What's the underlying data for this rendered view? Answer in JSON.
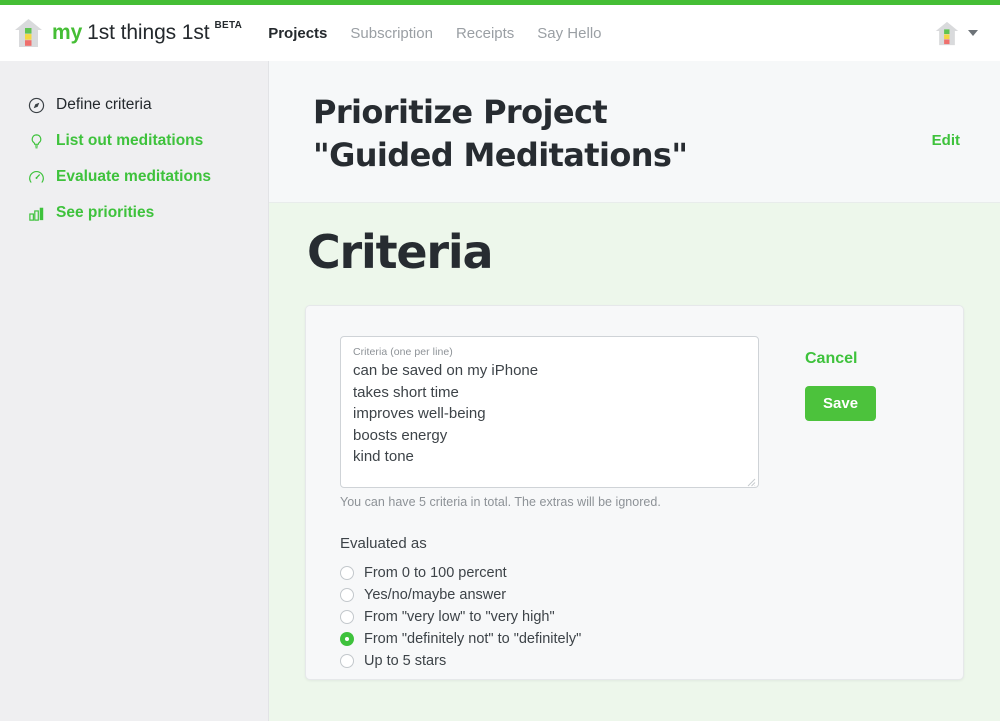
{
  "theme": {
    "brand_green": "#45be35",
    "link_green": "#3ec23c",
    "button_green": "#4cc23c",
    "sidebar_bg": "#efeff1",
    "header_bg": "#f6f8f9",
    "content_bg": "#edf7eb",
    "card_bg": "#f7f8f9",
    "text_dark": "#24292d"
  },
  "navbar": {
    "brand": {
      "my": "my",
      "rest": "1st things 1st",
      "beta": "BETA",
      "logo_icon": "house-logo-icon"
    },
    "links": [
      {
        "label": "Projects",
        "active": true
      },
      {
        "label": "Subscription",
        "active": false
      },
      {
        "label": "Receipts",
        "active": false
      },
      {
        "label": "Say Hello",
        "active": false
      }
    ],
    "avatar_icon": "house-avatar-icon",
    "caret_icon": "chevron-down-icon"
  },
  "sidebar": {
    "items": [
      {
        "label": "Define criteria",
        "icon": "compass-icon",
        "current": true
      },
      {
        "label": "List out meditations",
        "icon": "lightbulb-icon",
        "current": false
      },
      {
        "label": "Evaluate meditations",
        "icon": "gauge-icon",
        "current": false
      },
      {
        "label": "See priorities",
        "icon": "bar-chart-icon",
        "current": false
      }
    ]
  },
  "header": {
    "title_line1": "Prioritize Project",
    "title_line2": "\"Guided Meditations\"",
    "edit_label": "Edit"
  },
  "main": {
    "section_title": "Criteria",
    "form": {
      "textarea_label": "Criteria (one per line)",
      "textarea_value": "can be saved on my iPhone\ntakes short time\nimproves well-being\nboosts energy\nkind tone",
      "helper_text": "You can have 5 criteria in total. The extras will be ignored.",
      "eval_heading": "Evaluated as",
      "eval_options": [
        {
          "label": "From 0 to 100 percent",
          "checked": false
        },
        {
          "label": "Yes/no/maybe answer",
          "checked": false
        },
        {
          "label": "From \"very low\" to \"very high\"",
          "checked": false
        },
        {
          "label": "From \"definitely not\" to \"definitely\"",
          "checked": true
        },
        {
          "label": "Up to 5 stars",
          "checked": false
        }
      ],
      "cancel_label": "Cancel",
      "save_label": "Save"
    }
  }
}
